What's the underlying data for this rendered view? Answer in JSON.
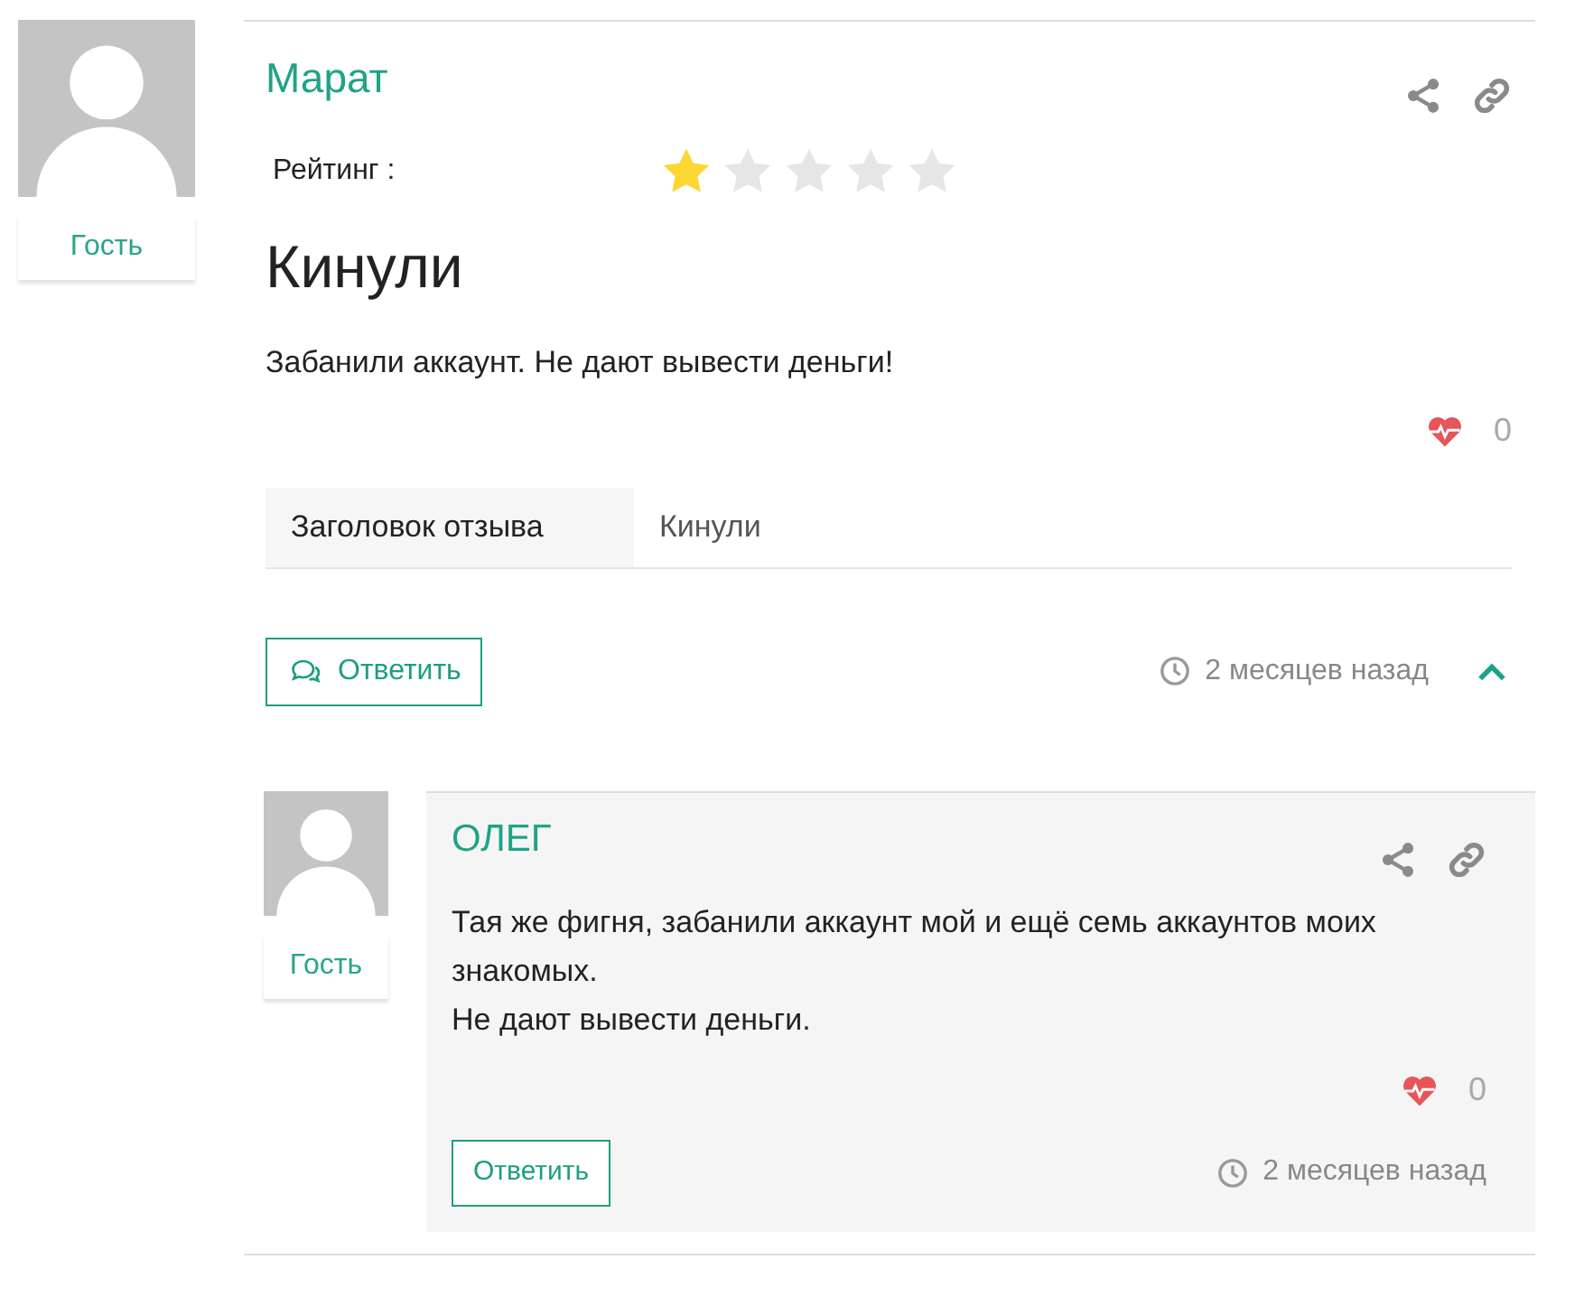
{
  "review": {
    "author": "Марат",
    "role": "Гость",
    "rating_label": "Рейтинг :",
    "stars": 1,
    "title": "Кинули",
    "text": "Забанили аккаунт. Не дают вывести деньги!",
    "likes": "0",
    "details": [
      {
        "label": "Заголовок отзыва",
        "value": "Кинули"
      }
    ],
    "reply_button": "Ответить",
    "time": "2 месяцев назад",
    "expanded": true
  },
  "replies": [
    {
      "author": "ОЛЕГ",
      "role": "Гость",
      "text": "Тая же фигня, забанили аккаунт мой и ещё семь аккаунтов моих знакомых.\nНе дают вывести деньги.",
      "likes": "0",
      "reply_button": "Ответить",
      "time": "2 месяцев назад"
    }
  ]
}
